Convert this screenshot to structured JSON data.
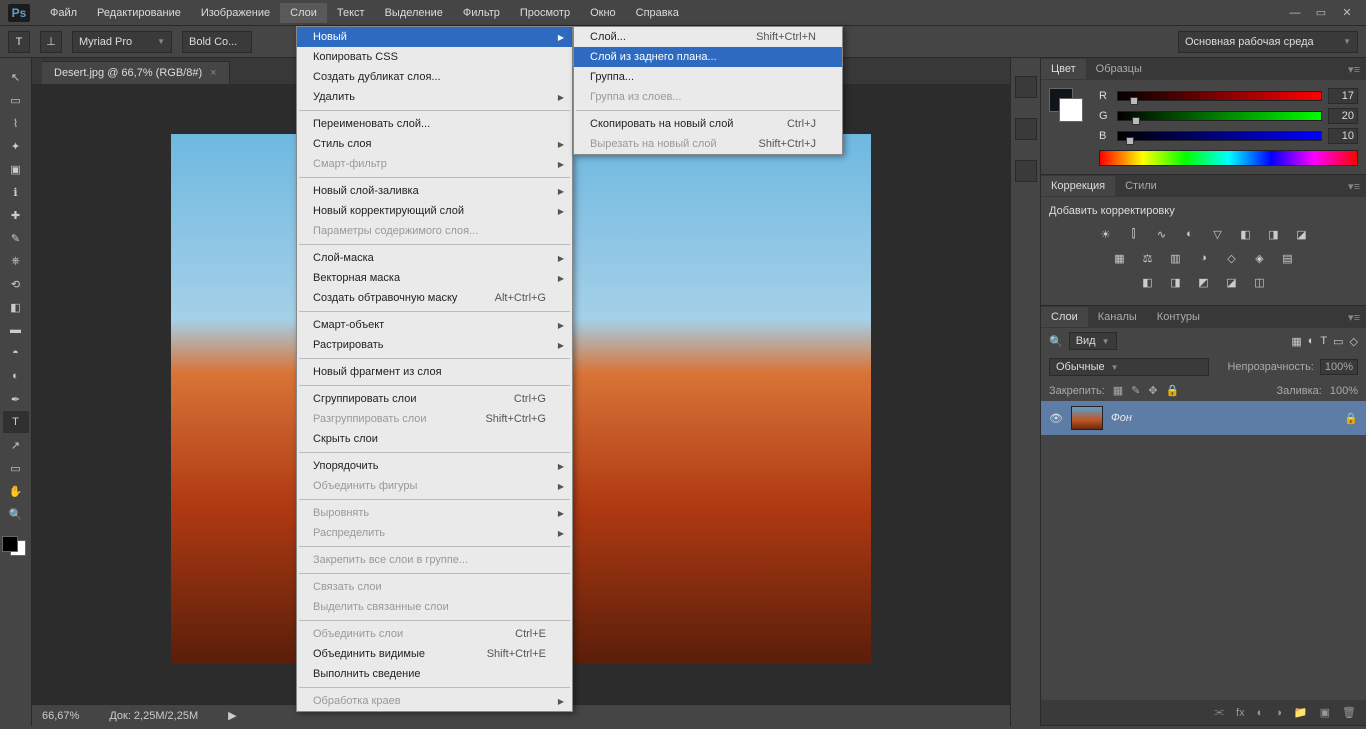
{
  "app": {
    "logo": "Ps"
  },
  "menubar": [
    "Файл",
    "Редактирование",
    "Изображение",
    "Слои",
    "Текст",
    "Выделение",
    "Фильтр",
    "Просмотр",
    "Окно",
    "Справка"
  ],
  "menubar_active": "Слои",
  "optbar": {
    "tool": "T",
    "font": "Myriad Pro",
    "style": "Bold Co...",
    "workspace": "Основная рабочая среда"
  },
  "tab": {
    "title": "Desert.jpg @ 66,7% (RGB/8#)"
  },
  "status": {
    "zoom": "66,67%",
    "doc": "Док: 2,25M/2,25M"
  },
  "menu1": [
    {
      "t": "Новый",
      "sub": true,
      "hl": true
    },
    {
      "t": "Копировать CSS"
    },
    {
      "t": "Создать дубликат слоя..."
    },
    {
      "t": "Удалить",
      "sub": true
    },
    {
      "sep": true
    },
    {
      "t": "Переименовать слой..."
    },
    {
      "t": "Стиль слоя",
      "sub": true
    },
    {
      "t": "Смарт-фильтр",
      "sub": true,
      "disabled": true
    },
    {
      "sep": true
    },
    {
      "t": "Новый слой-заливка",
      "sub": true
    },
    {
      "t": "Новый корректирующий слой",
      "sub": true
    },
    {
      "t": "Параметры содержимого слоя...",
      "disabled": true
    },
    {
      "sep": true
    },
    {
      "t": "Слой-маска",
      "sub": true
    },
    {
      "t": "Векторная маска",
      "sub": true
    },
    {
      "t": "Создать обтравочную маску",
      "sc": "Alt+Ctrl+G"
    },
    {
      "sep": true
    },
    {
      "t": "Смарт-объект",
      "sub": true
    },
    {
      "t": "Растрировать",
      "sub": true
    },
    {
      "sep": true
    },
    {
      "t": "Новый фрагмент из слоя"
    },
    {
      "sep": true
    },
    {
      "t": "Сгруппировать слои",
      "sc": "Ctrl+G"
    },
    {
      "t": "Разгруппировать слои",
      "sc": "Shift+Ctrl+G",
      "disabled": true
    },
    {
      "t": "Скрыть слои"
    },
    {
      "sep": true
    },
    {
      "t": "Упорядочить",
      "sub": true
    },
    {
      "t": "Объединить фигуры",
      "sub": true,
      "disabled": true
    },
    {
      "sep": true
    },
    {
      "t": "Выровнять",
      "sub": true,
      "disabled": true
    },
    {
      "t": "Распределить",
      "sub": true,
      "disabled": true
    },
    {
      "sep": true
    },
    {
      "t": "Закрепить все слои в группе...",
      "disabled": true
    },
    {
      "sep": true
    },
    {
      "t": "Связать слои",
      "disabled": true
    },
    {
      "t": "Выделить связанные слои",
      "disabled": true
    },
    {
      "sep": true
    },
    {
      "t": "Объединить слои",
      "sc": "Ctrl+E",
      "disabled": true
    },
    {
      "t": "Объединить видимые",
      "sc": "Shift+Ctrl+E"
    },
    {
      "t": "Выполнить сведение"
    },
    {
      "sep": true
    },
    {
      "t": "Обработка краев",
      "sub": true,
      "disabled": true
    }
  ],
  "menu2": [
    {
      "t": "Слой...",
      "sc": "Shift+Ctrl+N"
    },
    {
      "t": "Слой из заднего плана...",
      "hl": true
    },
    {
      "t": "Группа..."
    },
    {
      "t": "Группа из слоев...",
      "disabled": true
    },
    {
      "sep": true
    },
    {
      "t": "Скопировать на новый слой",
      "sc": "Ctrl+J"
    },
    {
      "t": "Вырезать на новый слой",
      "sc": "Shift+Ctrl+J",
      "disabled": true
    }
  ],
  "panels": {
    "color": {
      "tabs": [
        "Цвет",
        "Образцы"
      ],
      "r": 17,
      "g": 20,
      "b": 10
    },
    "adjust": {
      "tabs": [
        "Коррекция",
        "Стили"
      ],
      "title": "Добавить корректировку"
    },
    "layers": {
      "tabs": [
        "Слои",
        "Каналы",
        "Контуры"
      ],
      "filter": "Вид",
      "blend": "Обычные",
      "opacity_label": "Непрозрачность:",
      "opacity": "100%",
      "lock_label": "Закрепить:",
      "fill_label": "Заливка:",
      "fill": "100%",
      "layer": {
        "name": "Фон"
      }
    }
  }
}
